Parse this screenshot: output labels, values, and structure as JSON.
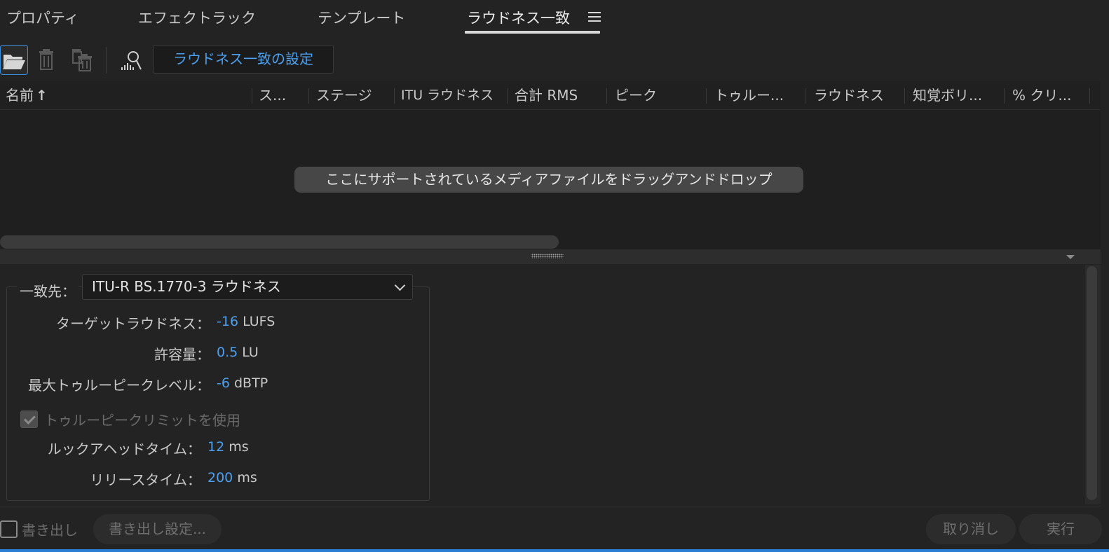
{
  "tabs": [
    {
      "label": "プロパティ"
    },
    {
      "label": "エフェクトラック"
    },
    {
      "label": "テンプレート"
    },
    {
      "label": "ラウドネス一致",
      "active": true
    }
  ],
  "toolbar": {
    "settings_label": "ラウドネス一致の設定"
  },
  "table": {
    "columns": [
      "名前",
      "ス...",
      "ステージ",
      "ITU ラウドネス",
      "合計 RMS",
      "ピーク",
      "トゥルー...",
      "ラウドネス",
      "知覚ボリ...",
      "% クリ..."
    ],
    "sort_indicator": "↑",
    "drop_hint": "ここにサポートされているメディアファイルをドラッグアンドドロップ"
  },
  "settings": {
    "match_to_label": "一致先：",
    "match_to_value": "ITU-R BS.1770-3 ラウドネス",
    "target_loudness_label": "ターゲットラウドネス：",
    "target_loudness_value": "-16",
    "target_loudness_unit": "LUFS",
    "tolerance_label": "許容量：",
    "tolerance_value": "0.5",
    "tolerance_unit": "LU",
    "max_true_peak_label": "最大トゥルーピークレベル：",
    "max_true_peak_value": "-6",
    "max_true_peak_unit": "dBTP",
    "use_limit_label": "トゥルーピークリミットを使用",
    "use_limit_checked": true,
    "lookahead_label": "ルックアヘッドタイム：",
    "lookahead_value": "12",
    "lookahead_unit": "ms",
    "release_label": "リリースタイム：",
    "release_value": "200",
    "release_unit": "ms"
  },
  "footer": {
    "export_label": "書き出し",
    "export_settings_label": "書き出し設定...",
    "cancel_label": "取り消し",
    "run_label": "実行"
  },
  "colors": {
    "accent": "#4ca0ef",
    "background": "#232323"
  }
}
